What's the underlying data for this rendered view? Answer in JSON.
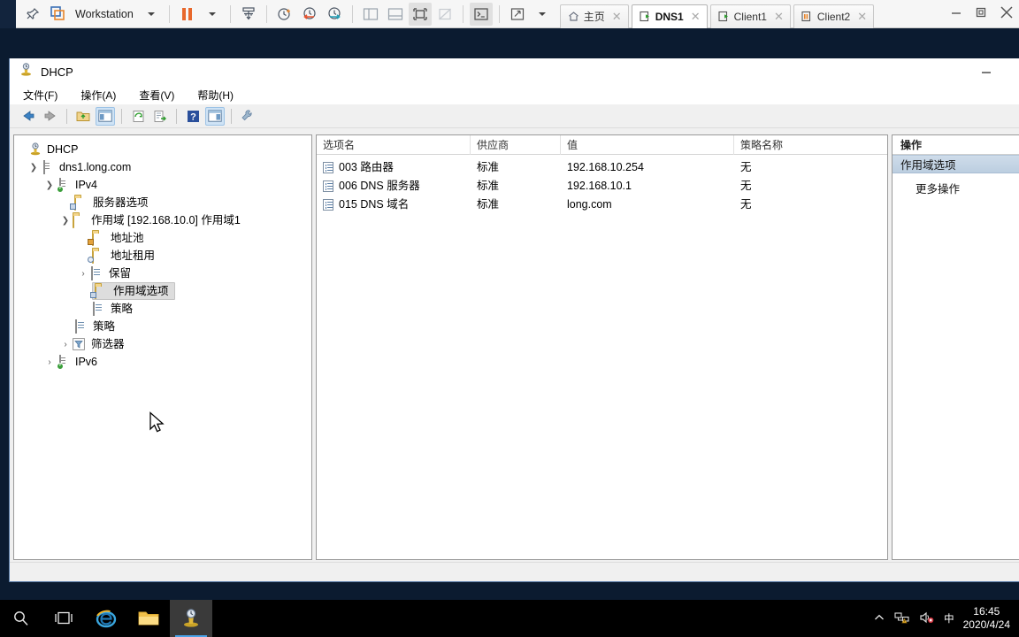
{
  "vmware": {
    "app_label": "Workstation",
    "toolbar_icons": [
      "pin-icon",
      "vm-library-icon",
      "pause-icon",
      "pause-dropdown-caret",
      "send-key-icon",
      "snapshot-icon",
      "revert-snapshot-icon",
      "snapshot-manager-icon",
      "sidebar-layout-icon",
      "bottom-layout-icon",
      "fullscreen-icon",
      "unity-icon",
      "console-icon",
      "expand-icon",
      "view-dropdown-caret"
    ],
    "tabs": [
      {
        "label": "主页",
        "icon": "home-icon",
        "active": false
      },
      {
        "label": "DNS1",
        "icon": "vm-powered-on-icon",
        "active": true
      },
      {
        "label": "Client1",
        "icon": "vm-powered-on-icon",
        "active": false
      },
      {
        "label": "Client2",
        "icon": "vm-suspended-icon",
        "active": false
      }
    ],
    "window_controls": [
      "minimize",
      "restore",
      "close"
    ]
  },
  "mmc": {
    "title": "DHCP",
    "title_icon": "dhcp-icon",
    "menu": [
      {
        "label": "文件(F)"
      },
      {
        "label": "操作(A)"
      },
      {
        "label": "查看(V)"
      },
      {
        "label": "帮助(H)"
      }
    ],
    "toolbar": [
      "back-icon",
      "forward-icon",
      "up-one-level-icon",
      "show-hide-tree-icon",
      "refresh-icon",
      "export-list-icon",
      "help-icon",
      "show-hide-action-pane-icon",
      "properties-icon"
    ],
    "status_text": ""
  },
  "tree": {
    "nodes": [
      {
        "label": "DHCP",
        "icon": "dhcp-icon",
        "indent": 0,
        "chevron": "",
        "selected": false
      },
      {
        "label": "dns1.long.com",
        "icon": "server-icon",
        "indent": 1,
        "chevron": "expanded",
        "selected": false
      },
      {
        "label": "IPv4",
        "icon": "ipv4-server-icon",
        "indent": 2,
        "chevron": "expanded",
        "selected": false
      },
      {
        "label": "服务器选项",
        "icon": "options-folder-icon",
        "indent": 3,
        "chevron": "",
        "selected": false
      },
      {
        "label": "作用域 [192.168.10.0] 作用域1",
        "icon": "folder-icon",
        "indent": 3,
        "chevron": "expanded",
        "selected": false
      },
      {
        "label": "地址池",
        "icon": "address-pool-icon",
        "indent": 4,
        "chevron": "",
        "selected": false
      },
      {
        "label": "地址租用",
        "icon": "address-lease-icon",
        "indent": 4,
        "chevron": "",
        "selected": false
      },
      {
        "label": "保留",
        "icon": "reservation-icon",
        "indent": 4,
        "chevron": "collapsed",
        "selected": false
      },
      {
        "label": "作用域选项",
        "icon": "scope-options-icon",
        "indent": 4,
        "chevron": "",
        "selected": true
      },
      {
        "label": "策略",
        "icon": "policy-icon",
        "indent": 4,
        "chevron": "",
        "selected": false
      },
      {
        "label": "策略",
        "icon": "policy-icon",
        "indent": 3,
        "chevron": "",
        "selected": false
      },
      {
        "label": "筛选器",
        "icon": "filter-icon",
        "indent": 3,
        "chevron": "collapsed",
        "selected": false
      },
      {
        "label": "IPv6",
        "icon": "ipv6-server-icon",
        "indent": 2,
        "chevron": "collapsed",
        "selected": false
      }
    ]
  },
  "list": {
    "columns": [
      "选项名",
      "供应商",
      "值",
      "策略名称"
    ],
    "rows": [
      {
        "name": "003 路由器",
        "vendor": "标准",
        "value": "192.168.10.254",
        "policy": "无"
      },
      {
        "name": "006 DNS 服务器",
        "vendor": "标准",
        "value": "192.168.10.1",
        "policy": "无"
      },
      {
        "name": "015 DNS 域名",
        "vendor": "标准",
        "value": "long.com",
        "policy": "无"
      }
    ]
  },
  "actions": {
    "header": "操作",
    "selected_item": "作用域选项",
    "more_item": "更多操作"
  },
  "taskbar": {
    "items": [
      {
        "name": "search-icon",
        "active": false
      },
      {
        "name": "task-view-icon",
        "active": false
      },
      {
        "name": "internet-explorer-icon",
        "active": false
      },
      {
        "name": "file-explorer-icon",
        "active": false
      },
      {
        "name": "dhcp-taskbar-icon",
        "active": true
      }
    ],
    "tray": [
      {
        "name": "show-hidden-icons-chevron"
      },
      {
        "name": "network-warning-icon"
      },
      {
        "name": "volume-muted-icon"
      },
      {
        "name": "ime-chinese-icon",
        "label": "中"
      }
    ],
    "clock_time": "16:45",
    "clock_date": "2020/4/24"
  },
  "colors": {
    "desktop": "#0b1b30",
    "vmware_bar": "#f6f6f6",
    "accent_orange": "#e8682c",
    "tree_selection": "#dddddd",
    "action_selection": "#c5d4e4",
    "taskbar": "#000000"
  }
}
